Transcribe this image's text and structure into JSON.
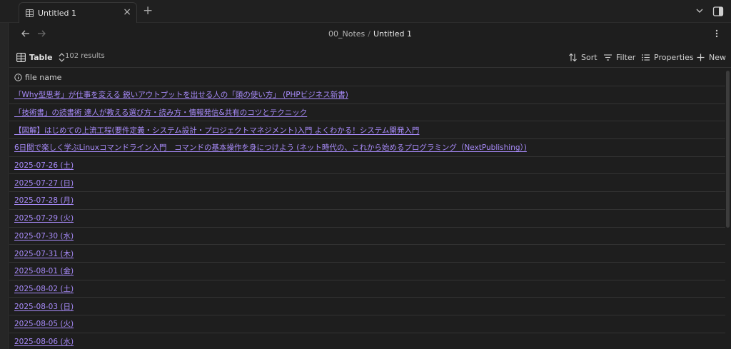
{
  "window": {
    "tab_title": "Untitled 1",
    "close_glyph": "×",
    "new_tab_glyph": "+"
  },
  "breadcrumb": {
    "folder": "00_Notes",
    "separator": "/",
    "current": "Untitled 1"
  },
  "toolbar": {
    "view_label": "Table",
    "results": "102 results",
    "sort_label": "Sort",
    "filter_label": "Filter",
    "properties_label": "Properties",
    "new_label": "New"
  },
  "table": {
    "column_header": "file name",
    "rows": [
      "「Why型思考」が仕事を変える 鋭いアウトプットを出せる人の「頭の使い方」 (PHPビジネス新書)",
      "「技術書」の読書術 達人が教える選び方・読み方・情報発信&共有のコツとテクニック",
      "【図解】はじめての上流工程(要件定義・システム設計・プロジェクトマネジメント)入門 よくわかる！システム開発入門",
      "6日間で楽しく学ぶLinuxコマンドライン入門　コマンドの基本操作を身につけよう (ネット時代の、これから始めるプログラミング（NextPublishing）)",
      "2025-07-26 (土)",
      "2025-07-27 (日)",
      "2025-07-28 (月)",
      "2025-07-29 (火)",
      "2025-07-30 (水)",
      "2025-07-31 (木)",
      "2025-08-01 (金)",
      "2025-08-02 (土)",
      "2025-08-03 (日)",
      "2025-08-05 (火)",
      "2025-08-06 (水)"
    ]
  },
  "colors": {
    "background": "#1e1e1e",
    "link": "#a88bfa",
    "text": "#dadada",
    "border": "#333333"
  }
}
